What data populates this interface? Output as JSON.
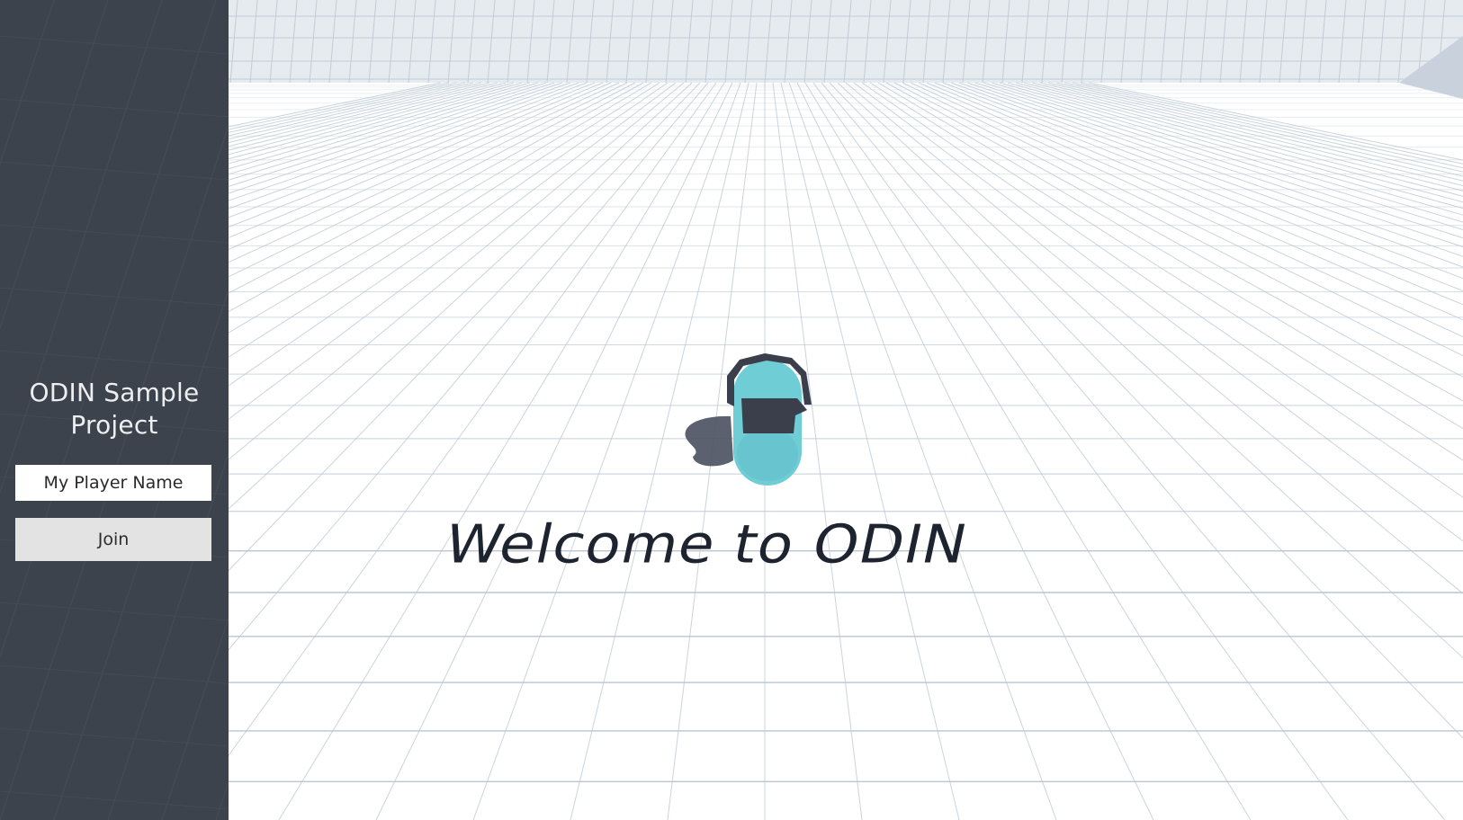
{
  "app": {
    "title": "ODIN Sample Project"
  },
  "menu": {
    "player_name_value": "My Player Name",
    "player_name_placeholder": "",
    "join_label": "Join"
  },
  "scene": {
    "floor_text": "Welcome to ODIN",
    "floor_color": "#ffffff",
    "grid_color": "#b9c6d1",
    "wall_color": "#e6ebf0",
    "sidebar_color": "#3d434c",
    "player_body_color": "#6fcdd6",
    "player_visor_color": "#3a3f4b"
  }
}
